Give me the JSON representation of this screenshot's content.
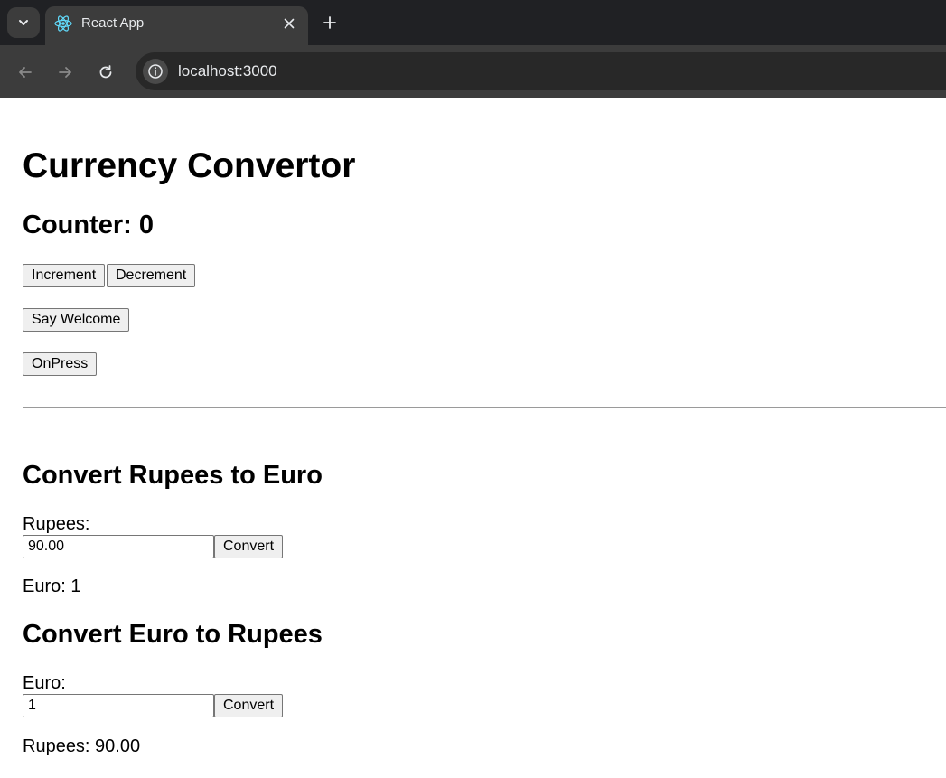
{
  "browser": {
    "tab_title": "React App",
    "url": "localhost:3000"
  },
  "page": {
    "title": "Currency Convertor",
    "counter": {
      "label": "Counter: 0",
      "increment_label": "Increment",
      "decrement_label": "Decrement"
    },
    "say_welcome_label": "Say Welcome",
    "onpress_label": "OnPress",
    "rupees_to_euro": {
      "heading": "Convert Rupees to Euro",
      "input_label": "Rupees:",
      "input_value": "90.00",
      "button_label": "Convert",
      "result": "Euro: 1"
    },
    "euro_to_rupees": {
      "heading": "Convert Euro to Rupees",
      "input_label": "Euro:",
      "input_value": "1",
      "button_label": "Convert",
      "result": "Rupees: 90.00"
    }
  }
}
